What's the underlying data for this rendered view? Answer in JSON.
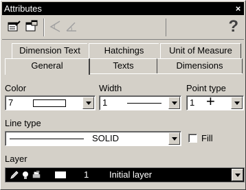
{
  "window": {
    "title": "Attributes",
    "close_glyph": "×"
  },
  "toolbar": {
    "buttons": [
      {
        "icon": "edit-attributes-icon"
      },
      {
        "icon": "window-attributes-icon"
      },
      {
        "icon": "angle-icon"
      },
      {
        "icon": "angle-alt-icon"
      }
    ],
    "help_label": "?"
  },
  "tabs": {
    "row1": [
      "Dimension Text",
      "Hatchings",
      "Unit of Measure"
    ],
    "row2": [
      "General",
      "Texts",
      "Dimensions"
    ],
    "selected": "General"
  },
  "general": {
    "color": {
      "label": "Color",
      "value": "7"
    },
    "width": {
      "label": "Width",
      "value": "1"
    },
    "point_type": {
      "label": "Point type",
      "value": "1",
      "symbol": "+"
    },
    "line_type": {
      "label": "Line type",
      "value": "SOLID"
    },
    "fill": {
      "label": "Fill",
      "checked": false
    },
    "layer": {
      "label": "Layer",
      "number": "1",
      "name": "Initial layer"
    }
  }
}
